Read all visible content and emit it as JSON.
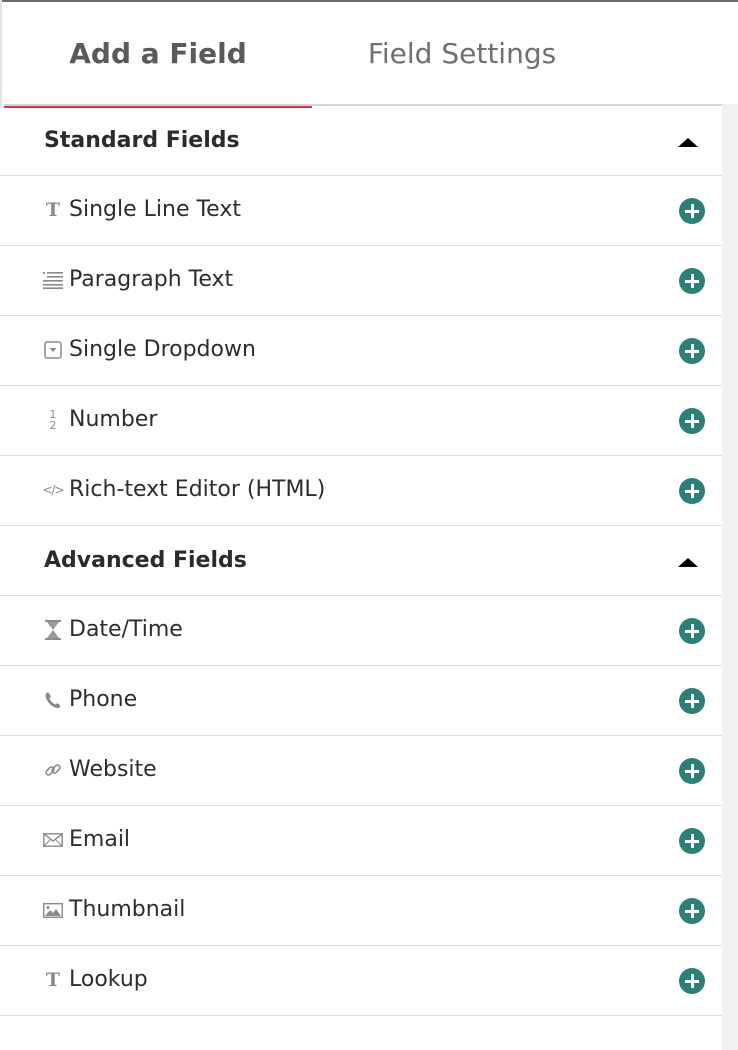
{
  "tabs": [
    {
      "label": "Add a Field",
      "active": true
    },
    {
      "label": "Field Settings",
      "active": false
    }
  ],
  "sections": [
    {
      "title": "Standard Fields",
      "fields": [
        {
          "label": "Single Line Text",
          "icon": "text-icon"
        },
        {
          "label": "Paragraph Text",
          "icon": "paragraph-icon"
        },
        {
          "label": "Single Dropdown",
          "icon": "dropdown-icon"
        },
        {
          "label": "Number",
          "icon": "number-icon",
          "glyph_top": "1",
          "glyph_bottom": "2"
        },
        {
          "label": "Rich-text Editor (HTML)",
          "icon": "code-icon"
        }
      ]
    },
    {
      "title": "Advanced Fields",
      "fields": [
        {
          "label": "Date/Time",
          "icon": "hourglass-icon"
        },
        {
          "label": "Phone",
          "icon": "phone-icon"
        },
        {
          "label": "Website",
          "icon": "link-icon"
        },
        {
          "label": "Email",
          "icon": "envelope-icon"
        },
        {
          "label": "Thumbnail",
          "icon": "image-icon"
        },
        {
          "label": "Lookup",
          "icon": "text-icon"
        }
      ]
    }
  ],
  "colors": {
    "active_tab_underline": "#d9354a",
    "add_button": "#2f7f79"
  }
}
